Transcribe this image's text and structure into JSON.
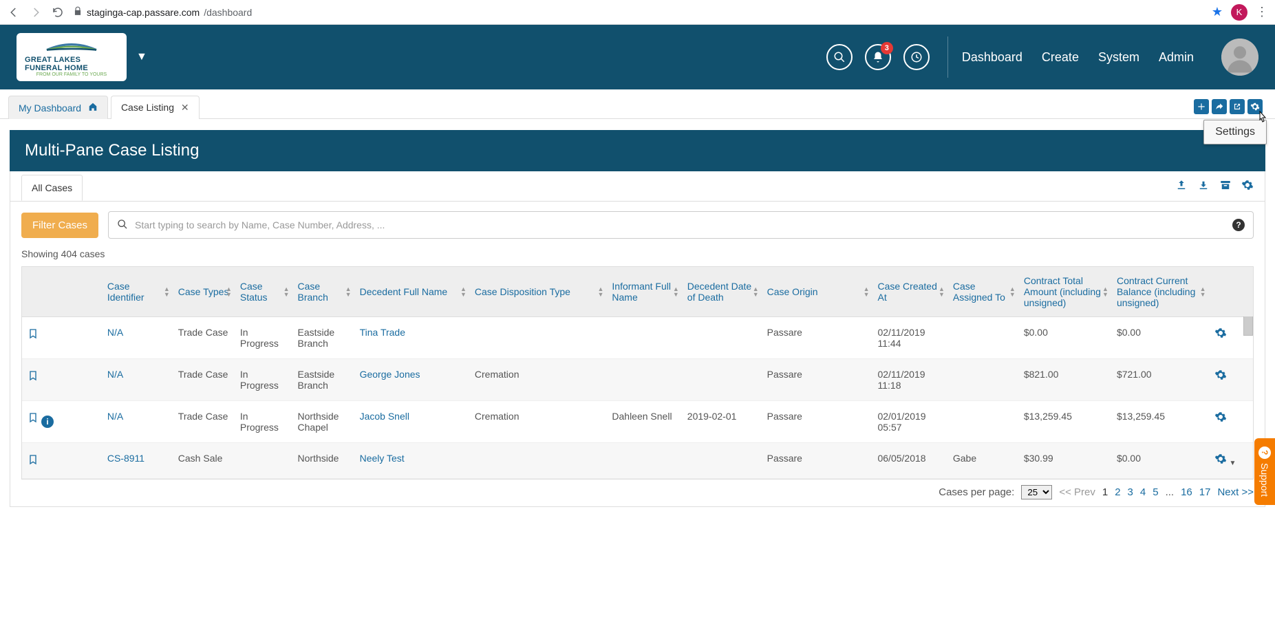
{
  "browser": {
    "url_host": "staginga-cap.passare.com",
    "url_path": "/dashboard",
    "avatar_letter": "K"
  },
  "header": {
    "logo_line1": "GREAT LAKES FUNERAL HOME",
    "logo_line2": "FROM OUR FAMILY TO YOURS",
    "notif_count": "3",
    "nav": [
      "Dashboard",
      "Create",
      "System",
      "Admin"
    ]
  },
  "tabs": {
    "dash": "My Dashboard",
    "listing": "Case Listing",
    "tooltip": "Settings"
  },
  "page": {
    "title": "Multi-Pane Case Listing",
    "subtab": "All Cases",
    "filter_btn": "Filter Cases",
    "search_placeholder": "Start typing to search by Name, Case Number, Address, ...",
    "count_text": "Showing 404 cases"
  },
  "columns": [
    "",
    "Case Identifier",
    "Case Types",
    "Case Status",
    "Case Branch",
    "Decedent Full Name",
    "Case Disposition Type",
    "Informant Full Name",
    "Decedent Date of Death",
    "Case Origin",
    "Case Created At",
    "Case Assigned To",
    "Contract Total Amount (including unsigned)",
    "Contract Current Balance (including unsigned)",
    ""
  ],
  "rows": [
    {
      "id": "N/A",
      "types": "Trade Case",
      "status": "In Progress",
      "branch": "Eastside Branch",
      "decedent": "Tina Trade",
      "disp": "",
      "informant": "",
      "dod": "",
      "origin": "Passare",
      "created": "02/11/2019 11:44",
      "assigned": "",
      "total": "$0.00",
      "balance": "$0.00",
      "info": false,
      "caret": false
    },
    {
      "id": "N/A",
      "types": "Trade Case",
      "status": "In Progress",
      "branch": "Eastside Branch",
      "decedent": "George Jones",
      "disp": "Cremation",
      "informant": "",
      "dod": "",
      "origin": "Passare",
      "created": "02/11/2019 11:18",
      "assigned": "",
      "total": "$821.00",
      "balance": "$721.00",
      "info": false,
      "caret": false
    },
    {
      "id": "N/A",
      "types": "Trade Case",
      "status": "In Progress",
      "branch": "Northside Chapel",
      "decedent": "Jacob Snell",
      "disp": "Cremation",
      "informant": "Dahleen Snell",
      "dod": "2019-02-01",
      "origin": "Passare",
      "created": "02/01/2019 05:57",
      "assigned": "",
      "total": "$13,259.45",
      "balance": "$13,259.45",
      "info": true,
      "caret": false
    },
    {
      "id": "CS-8911",
      "types": "Cash Sale",
      "status": "",
      "branch": "Northside",
      "decedent": "Neely Test",
      "disp": "",
      "informant": "",
      "dod": "",
      "origin": "Passare",
      "created": "06/05/2018",
      "assigned": "Gabe",
      "total": "$30.99",
      "balance": "$0.00",
      "info": false,
      "caret": true
    }
  ],
  "pager": {
    "label": "Cases per page:",
    "per_page": "25",
    "prev": "<< Prev",
    "pages": [
      "1",
      "2",
      "3",
      "4",
      "5",
      "...",
      "16",
      "17"
    ],
    "next": "Next >>"
  },
  "support": "Support"
}
